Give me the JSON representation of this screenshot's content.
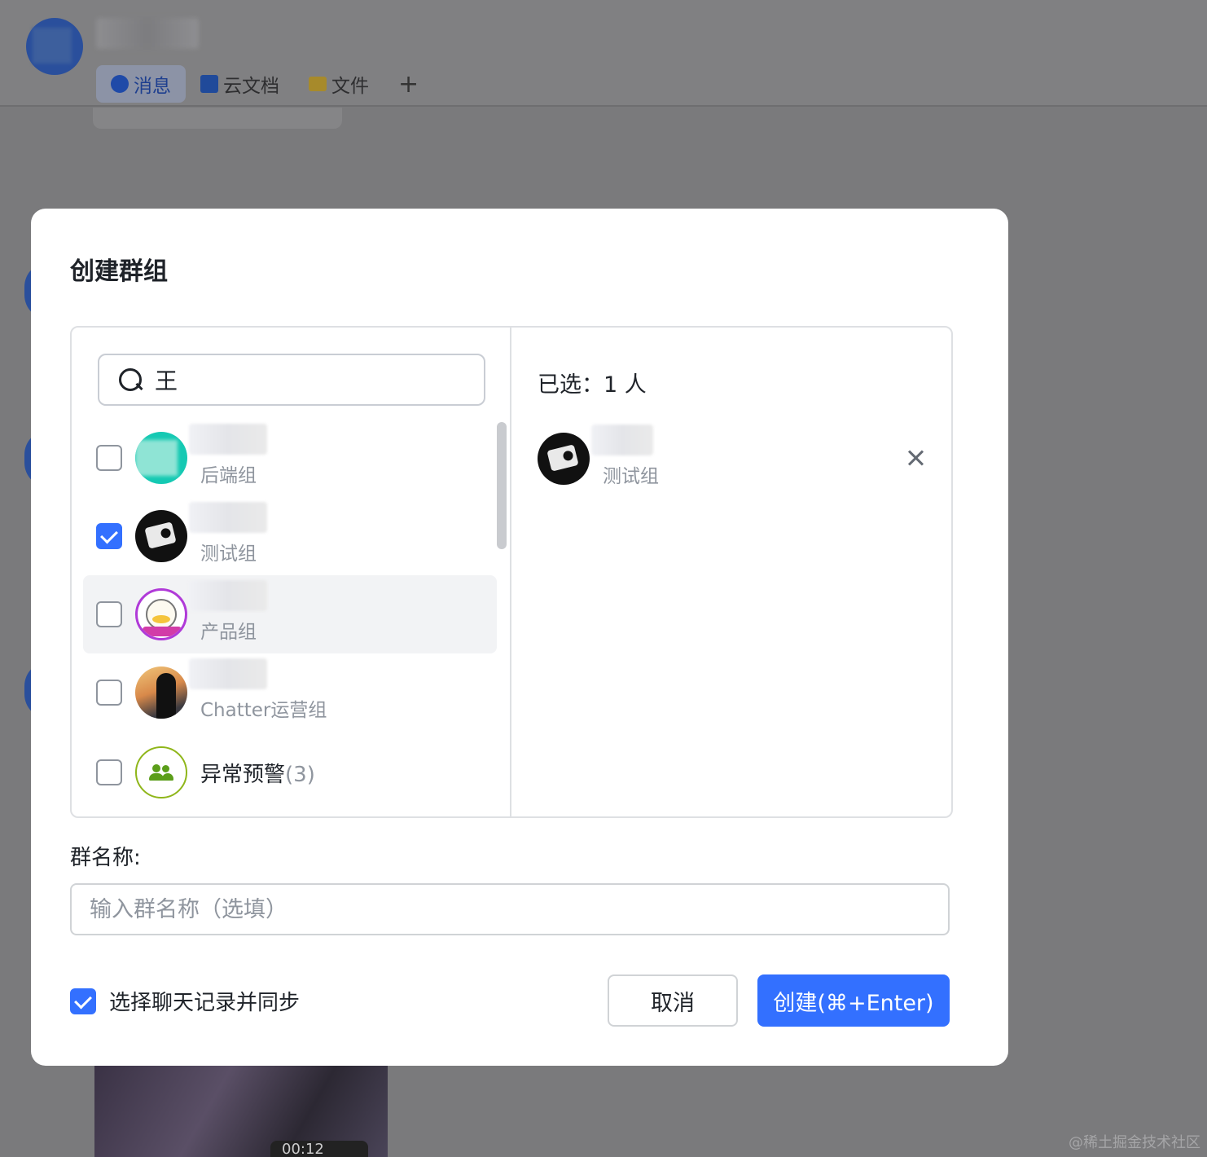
{
  "background": {
    "tabs": [
      {
        "label": "消息",
        "icon": "message-icon",
        "active": true
      },
      {
        "label": "云文档",
        "icon": "doc-icon",
        "active": false
      },
      {
        "label": "文件",
        "icon": "folder-icon",
        "active": false
      }
    ],
    "add_tab_glyph": "+",
    "video_duration": "00:12",
    "watermark": "@稀土掘金技术社区"
  },
  "dialog": {
    "title": "创建群组",
    "search": {
      "value": "王",
      "icon": "search-icon"
    },
    "results": [
      {
        "subtitle": "后端组",
        "checked": false,
        "avatar": "teal-avatar"
      },
      {
        "subtitle": "测试组",
        "checked": true,
        "avatar": "camera-avatar"
      },
      {
        "subtitle": "产品组",
        "checked": false,
        "avatar": "duck-avatar",
        "hovered": true
      },
      {
        "subtitle": "Chatter运营组",
        "checked": false,
        "avatar": "silhouette-avatar"
      },
      {
        "name": "异常预警",
        "count": "(3)",
        "checked": false,
        "avatar": "group-icon"
      }
    ],
    "selected": {
      "label": "已选：1 人",
      "items": [
        {
          "subtitle": "测试组",
          "avatar": "camera-avatar"
        }
      ]
    },
    "group_name": {
      "label": "群名称:",
      "placeholder": "输入群名称（选填）",
      "value": ""
    },
    "sync_history": {
      "label": "选择聊天记录并同步",
      "checked": true
    },
    "buttons": {
      "cancel": "取消",
      "create": "创建(⌘+Enter)"
    },
    "colors": {
      "primary": "#3370ff",
      "border": "#dee0e3",
      "muted_text": "#8f959e"
    }
  }
}
